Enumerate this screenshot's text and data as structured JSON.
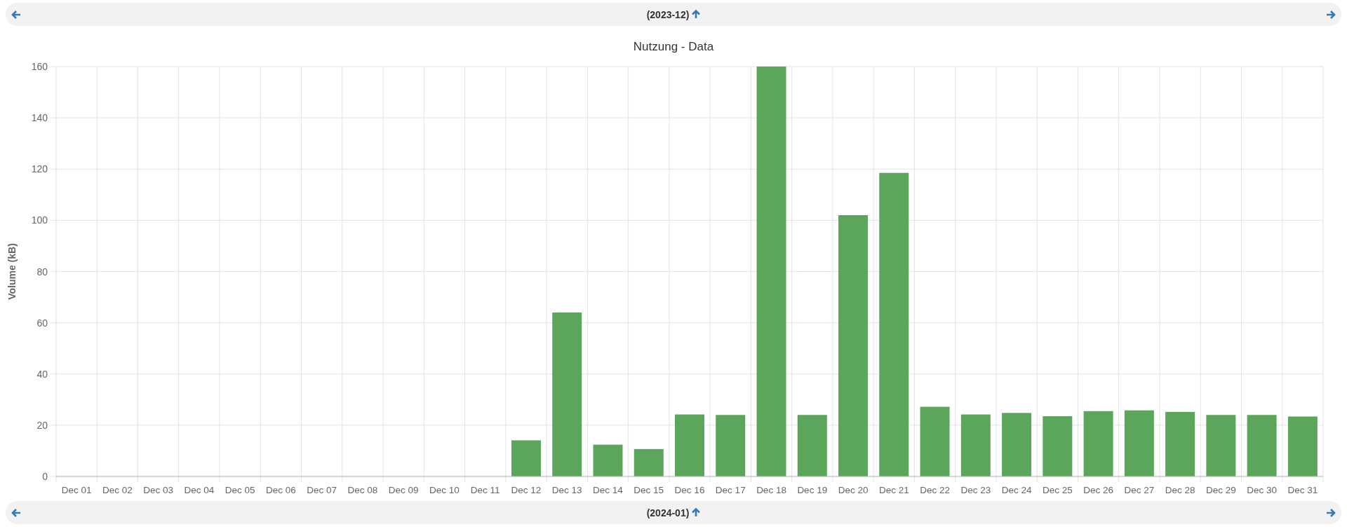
{
  "top_nav": {
    "label": "(2023-12)"
  },
  "chart": {
    "chart_data": {
      "type": "bar",
      "title": "Nutzung - Data",
      "ylabel": "Volume (kB)",
      "categories": [
        "Dec 01",
        "Dec 02",
        "Dec 03",
        "Dec 04",
        "Dec 05",
        "Dec 06",
        "Dec 07",
        "Dec 08",
        "Dec 09",
        "Dec 10",
        "Dec 11",
        "Dec 12",
        "Dec 13",
        "Dec 14",
        "Dec 15",
        "Dec 16",
        "Dec 17",
        "Dec 18",
        "Dec 19",
        "Dec 20",
        "Dec 21",
        "Dec 22",
        "Dec 23",
        "Dec 24",
        "Dec 25",
        "Dec 26",
        "Dec 27",
        "Dec 28",
        "Dec 29",
        "Dec 30",
        "Dec 31"
      ],
      "grid": true,
      "series": [
        {
          "color": "#5ba65b",
          "values": [
            0,
            0,
            0,
            0,
            0,
            0,
            0,
            0,
            0,
            0,
            0,
            14.1,
            64,
            12.4,
            10.7,
            24.2,
            24,
            160,
            24,
            102,
            118.5,
            27.2,
            24.2,
            24.8,
            23.5,
            25.5,
            25.8,
            25.2,
            24,
            24,
            23.4
          ]
        }
      ],
      "ylim": [
        0,
        160
      ],
      "yticks": [
        0,
        20,
        40,
        60,
        80,
        100,
        120,
        140,
        160
      ]
    }
  },
  "bottom_nav": {
    "label": "(2024-01)"
  }
}
